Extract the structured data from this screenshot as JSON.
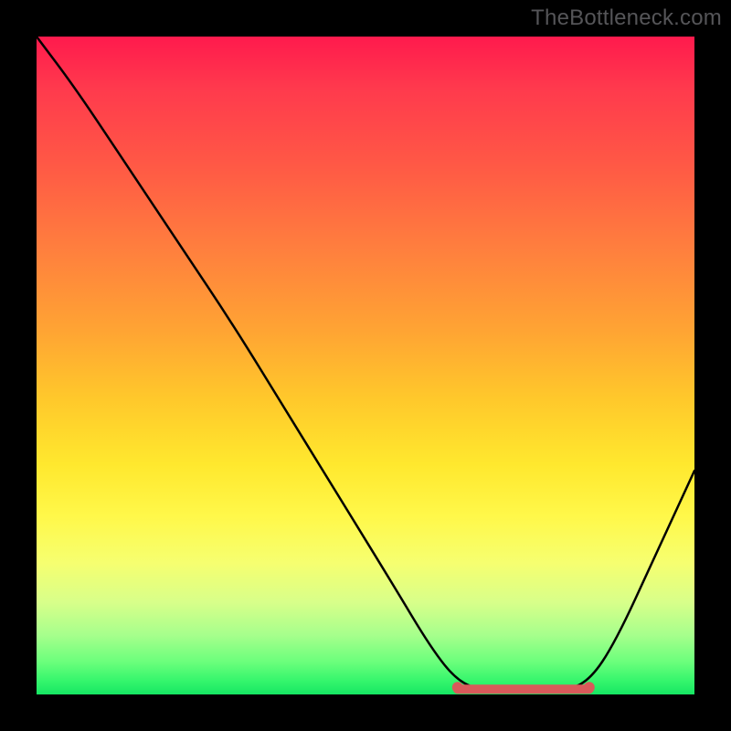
{
  "watermark": "TheBottleneck.com",
  "colors": {
    "curve_stroke": "#000000",
    "marker_stroke": "#d85a5a",
    "marker_end_fill": "#d85a5a"
  },
  "chart_data": {
    "type": "line",
    "title": "",
    "xlabel": "",
    "ylabel": "",
    "xlim": [
      0,
      100
    ],
    "ylim": [
      0,
      100
    ],
    "curve_points": [
      {
        "x": 0,
        "y": 100
      },
      {
        "x": 6,
        "y": 92
      },
      {
        "x": 14,
        "y": 80
      },
      {
        "x": 22,
        "y": 68
      },
      {
        "x": 30,
        "y": 56
      },
      {
        "x": 38,
        "y": 43
      },
      {
        "x": 46,
        "y": 30
      },
      {
        "x": 54,
        "y": 17
      },
      {
        "x": 60,
        "y": 7
      },
      {
        "x": 64,
        "y": 2
      },
      {
        "x": 68,
        "y": 0.5
      },
      {
        "x": 74,
        "y": 0.5
      },
      {
        "x": 80,
        "y": 0.5
      },
      {
        "x": 84,
        "y": 2
      },
      {
        "x": 88,
        "y": 8
      },
      {
        "x": 94,
        "y": 21
      },
      {
        "x": 100,
        "y": 34
      }
    ],
    "highlight_segment": {
      "start_x": 64,
      "end_x": 84,
      "y": 0.8
    }
  }
}
